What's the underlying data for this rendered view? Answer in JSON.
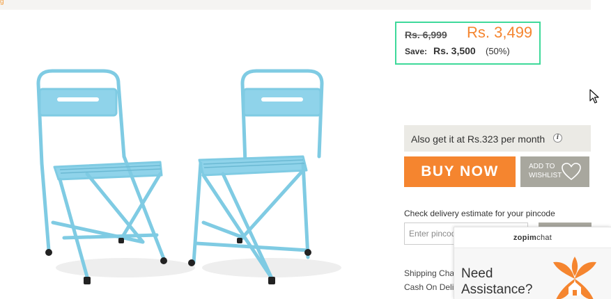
{
  "top_strip": {
    "mark": "g"
  },
  "product": {
    "image_icon": "folding-chair-pair-icon",
    "image_color": "#7fcbe3"
  },
  "price": {
    "mrp": "Rs. 6,999",
    "sale": "Rs. 3,499",
    "save_label": "Save:",
    "save_amount": "Rs. 3,500",
    "save_percent": "(50%)"
  },
  "emi": {
    "text": "Also get it at Rs.323 per month",
    "info_icon": "i"
  },
  "actions": {
    "buy_now": "BUY NOW",
    "wishlist": "ADD TO WISHLIST"
  },
  "pincode": {
    "label": "Check delivery estimate for your pincode",
    "placeholder": "Enter pincode"
  },
  "shipping": {
    "shipping_text": "Shipping Charges",
    "cod_text": "Cash On Delivery"
  },
  "chat": {
    "brand_prefix": "zopim",
    "brand_suffix": "chat",
    "message": "Need Assistance?"
  },
  "colors": {
    "accent_orange": "#f5852f",
    "price_border": "#3ed99a",
    "neutral_button": "#a8a79e",
    "emi_background": "#ebeae5"
  }
}
